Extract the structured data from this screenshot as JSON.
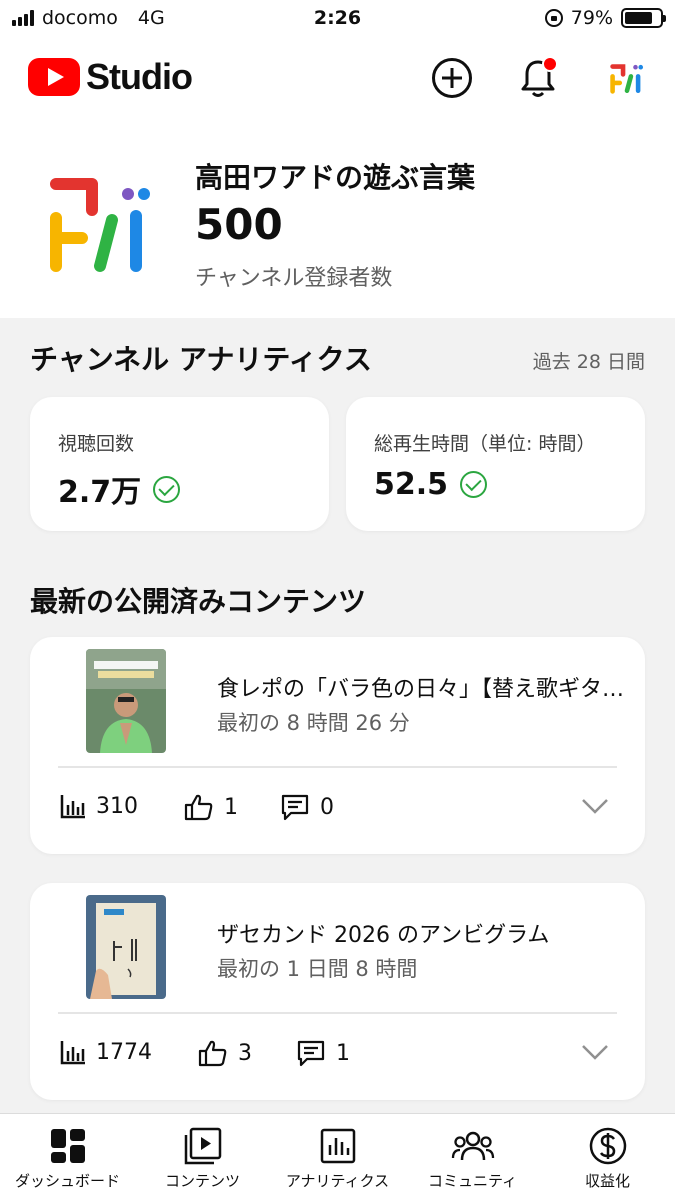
{
  "status_bar": {
    "carrier": "docomo",
    "network": "4G",
    "time": "2:26",
    "battery": "79%",
    "battery_level": 0.79
  },
  "header": {
    "app_name": "Studio",
    "brand_color": "#ff0000",
    "icons": [
      "create-icon",
      "notifications-icon",
      "channel-avatar-icon"
    ],
    "notification_badge_color": "#ff0000"
  },
  "channel": {
    "name": "高田ワアドの遊ぶ言葉",
    "subscribers": "500",
    "subscribers_label": "チャンネル登録者数"
  },
  "analytics": {
    "title": "チャンネル アナリティクス",
    "period": "過去 28 日間",
    "metrics": [
      {
        "label": "視聴回数",
        "value": "2.7万"
      },
      {
        "label": "総再生時間（単位: 時間）",
        "value": "52.5"
      }
    ]
  },
  "latest": {
    "title": "最新の公開済みコンテンツ",
    "videos": [
      {
        "title": "食レポの「バラ色の日々」【替え歌ギター】",
        "subtitle": "最初の 8 時間 26 分",
        "views": "310",
        "likes": "1",
        "comments": "0"
      },
      {
        "title": "ザセカンド 2026 のアンビグラム",
        "subtitle": "最初の 1 日間 8 時間",
        "views": "1774",
        "likes": "3",
        "comments": "1"
      }
    ]
  },
  "bottom_nav": [
    {
      "label": "ダッシュボード",
      "icon": "dashboard-icon"
    },
    {
      "label": "コンテンツ",
      "icon": "content-icon"
    },
    {
      "label": "アナリティクス",
      "icon": "analytics-icon"
    },
    {
      "label": "コミュニティ",
      "icon": "community-icon"
    },
    {
      "label": "収益化",
      "icon": "monetization-icon"
    }
  ],
  "colors": {
    "accent": "#ff0000",
    "check": "#2ba640",
    "secondary_text": "#606060",
    "background": "#f2f2f2"
  }
}
